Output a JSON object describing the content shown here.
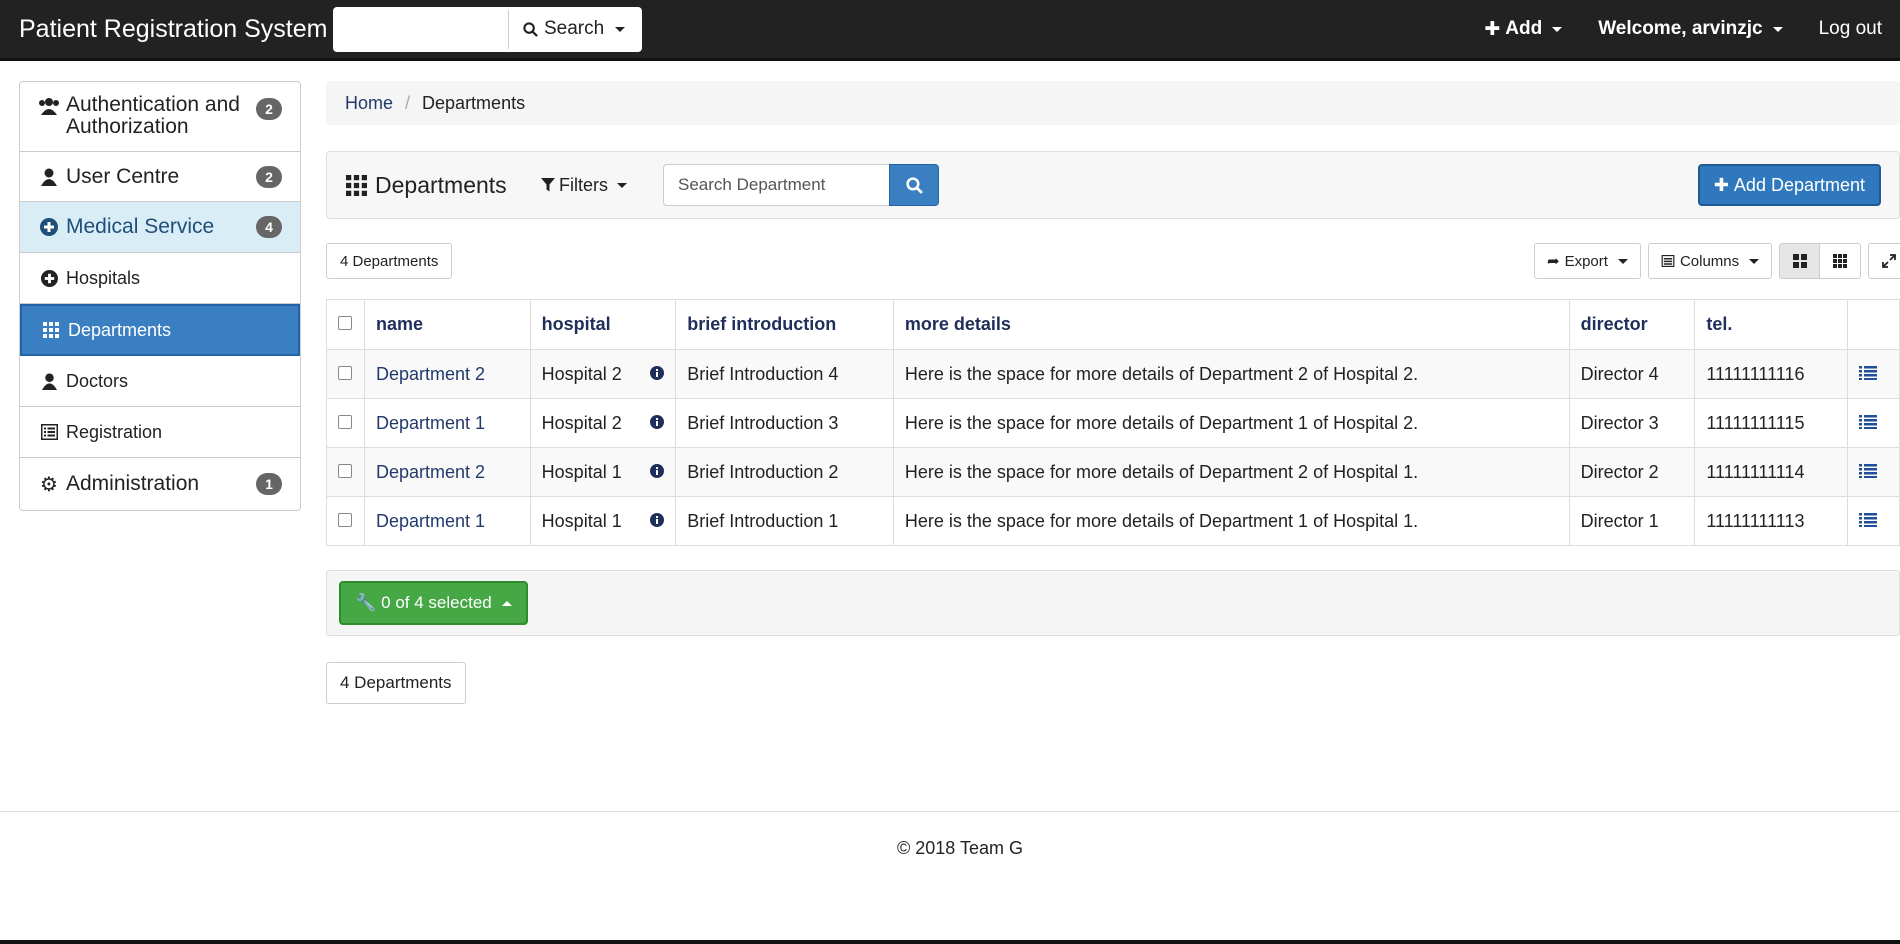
{
  "navbar": {
    "brand": "Patient Registration System",
    "search_label": "Search",
    "search_value": "",
    "add_label": "Add",
    "welcome_label": "Welcome, arvinzjc",
    "logout_label": "Log out"
  },
  "sidebar": {
    "items": [
      {
        "label": "Authentication and Authorization",
        "badge": "2",
        "icon": "users-icon"
      },
      {
        "label": "User Centre",
        "badge": "2",
        "icon": "user-icon"
      },
      {
        "label": "Medical Service",
        "badge": "4",
        "icon": "plus-circle-icon"
      },
      {
        "label": "Hospitals",
        "icon": "plus-circle-icon"
      },
      {
        "label": "Departments",
        "icon": "grid-icon"
      },
      {
        "label": "Doctors",
        "icon": "user-icon"
      },
      {
        "label": "Registration",
        "icon": "list-alt-icon"
      },
      {
        "label": "Administration",
        "badge": "1",
        "icon": "gear-icon"
      }
    ]
  },
  "breadcrumb": {
    "home": "Home",
    "current": "Departments"
  },
  "toolbar": {
    "title": "Departments",
    "filters_label": "Filters",
    "search_placeholder": "Search Department",
    "add_label": "Add Department"
  },
  "count_label": "4 Departments",
  "tools": {
    "export_label": "Export",
    "columns_label": "Columns"
  },
  "table": {
    "headers": [
      "name",
      "hospital",
      "brief introduction",
      "more details",
      "director",
      "tel."
    ],
    "rows": [
      {
        "name": "Department 2",
        "hospital": "Hospital 2",
        "brief": "Brief Introduction 4",
        "details": "Here is the space for more details of Department 2 of Hospital 2.",
        "director": "Director 4",
        "tel": "11111111116"
      },
      {
        "name": "Department 1",
        "hospital": "Hospital 2",
        "brief": "Brief Introduction 3",
        "details": "Here is the space for more details of Department 1 of Hospital 2.",
        "director": "Director 3",
        "tel": "11111111115"
      },
      {
        "name": "Department 2",
        "hospital": "Hospital 1",
        "brief": "Brief Introduction 2",
        "details": "Here is the space for more details of Department 2 of Hospital 1.",
        "director": "Director 2",
        "tel": "11111111114"
      },
      {
        "name": "Department 1",
        "hospital": "Hospital 1",
        "brief": "Brief Introduction 1",
        "details": "Here is the space for more details of Department 1 of Hospital 1.",
        "director": "Director 1",
        "tel": "11111111113"
      }
    ]
  },
  "selection_label": "0 of 4 selected",
  "footer": "© 2018 Team G",
  "colors": {
    "primary": "#3a7fc1",
    "success": "#45a845",
    "navbar": "#222222",
    "link": "#223a6b"
  }
}
